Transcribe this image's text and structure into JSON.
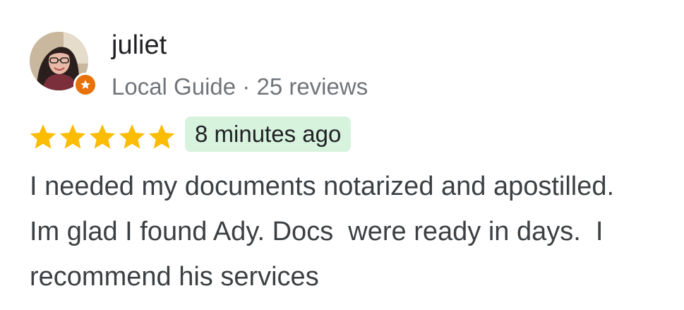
{
  "reviewer": {
    "name": "juliet",
    "badge": "Local Guide",
    "separator": "·",
    "review_count": "25 reviews",
    "avatar_icon": "user-photo",
    "badge_icon": "star-badge-icon"
  },
  "rating": {
    "stars": 5,
    "max": 5,
    "color": "#fbbc04"
  },
  "time_ago": "8 minutes ago",
  "review_lines": [
    "I needed my documents notarized and apostilled.",
    "Im glad I found Ady. Docs  were ready in days.  I",
    "recommend his services"
  ]
}
